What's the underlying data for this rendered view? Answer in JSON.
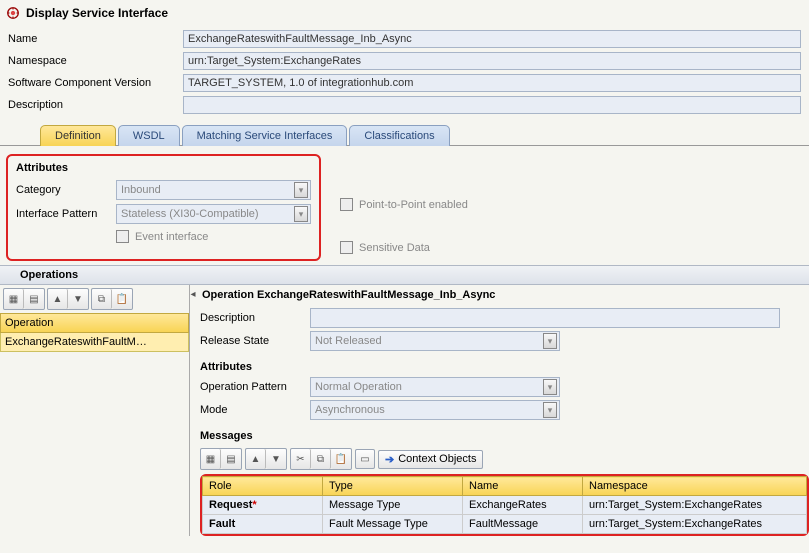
{
  "header": {
    "title": "Display Service Interface",
    "fields": {
      "name_label": "Name",
      "name_value": "ExchangeRateswithFaultMessage_Inb_Async",
      "namespace_label": "Namespace",
      "namespace_value": "urn:Target_System:ExchangeRates",
      "swc_label": "Software Component Version",
      "swc_value": "TARGET_SYSTEM, 1.0 of integrationhub.com",
      "desc_label": "Description",
      "desc_value": ""
    }
  },
  "tabs": {
    "definition": "Definition",
    "wsdl": "WSDL",
    "matching": "Matching Service Interfaces",
    "classifications": "Classifications"
  },
  "attributes": {
    "title": "Attributes",
    "category_label": "Category",
    "category_value": "Inbound",
    "pattern_label": "Interface Pattern",
    "pattern_value": "Stateless (XI30-Compatible)",
    "event_interface": "Event interface",
    "point_to_point": "Point-to-Point enabled",
    "sensitive_data": "Sensitive Data"
  },
  "operations": {
    "section_title": "Operations",
    "col_header": "Operation",
    "selected": "ExchangeRateswithFaultM…"
  },
  "op_detail": {
    "title": "Operation ExchangeRateswithFaultMessage_Inb_Async",
    "description_label": "Description",
    "description_value": "",
    "release_label": "Release State",
    "release_value": "Not Released",
    "attributes_title": "Attributes",
    "op_pattern_label": "Operation Pattern",
    "op_pattern_value": "Normal Operation",
    "mode_label": "Mode",
    "mode_value": "Asynchronous"
  },
  "messages": {
    "title": "Messages",
    "context_objects": "Context Objects",
    "columns": {
      "role": "Role",
      "type": "Type",
      "name": "Name",
      "namespace": "Namespace"
    },
    "rows": [
      {
        "role": "Request",
        "required": "*",
        "type": "Message Type",
        "name": "ExchangeRates",
        "namespace": "urn:Target_System:ExchangeRates"
      },
      {
        "role": "Fault",
        "required": "",
        "type": "Fault Message Type",
        "name": "FaultMessage",
        "namespace": "urn:Target_System:ExchangeRates"
      }
    ]
  }
}
